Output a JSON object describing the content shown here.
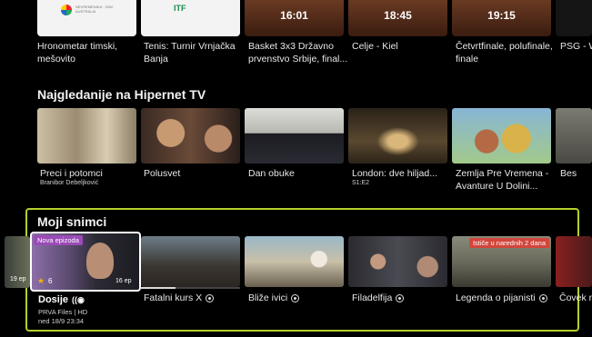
{
  "top_row": {
    "cards": [
      {
        "time": "",
        "logo_text": "NEVREMENIKA · 2000\nAUSTRALIA",
        "caption": "Hronometar timski, mešovito"
      },
      {
        "time": "",
        "logo_text": "ITF",
        "caption": "Tenis: Turnir Vrnjačka Banja"
      },
      {
        "time": "16:01",
        "caption": "Basket 3x3 Državno prvenstvo Srbije, final..."
      },
      {
        "time": "18:45",
        "caption": "Celje - Kiel"
      },
      {
        "time": "19:15",
        "caption": "Četvrtfinale, polufinale, finale"
      },
      {
        "time": "",
        "caption": "PSG - Wis"
      }
    ]
  },
  "most_watched": {
    "title": "Najgledanije na Hipernet TV",
    "items": [
      {
        "title": "Preci i potomci",
        "subtitle": "Branibor Debeljković"
      },
      {
        "title": "Polusvet",
        "subtitle": ""
      },
      {
        "title": "Dan obuke",
        "subtitle": ""
      },
      {
        "title": "London: dve hiljad...",
        "subtitle": "S1:E2"
      },
      {
        "title": "Zemlja Pre Vremena - Avanture U Dolini...",
        "subtitle": ""
      },
      {
        "title": "Bes",
        "subtitle": ""
      }
    ]
  },
  "recordings": {
    "title": "Moji snimci",
    "selected": {
      "badge": "Nova epizoda",
      "rating": "6",
      "episodes": "16 ep",
      "title": "Dosije",
      "channel": "PRVA Files | HD",
      "datetime": "ned 18/9 23:34"
    },
    "left_partial_ep": "19 ep",
    "items": [
      {
        "title": "Fatalni kurs X",
        "badge": "",
        "progress": 0.35
      },
      {
        "title": "Bliže ivici",
        "badge": "",
        "progress": 0.0
      },
      {
        "title": "Filadelfija",
        "badge": "",
        "progress": 0.0
      },
      {
        "title": "Legenda o pijanisti",
        "badge": "Ističe u narednih 2 dana",
        "progress": 0.0
      },
      {
        "title": "Čovek n",
        "badge": "",
        "progress": 0.0
      }
    ]
  },
  "colors": {
    "accent": "#b7cf2c",
    "badge_new": "#9b4bb8",
    "badge_expiring": "#d2463c"
  }
}
